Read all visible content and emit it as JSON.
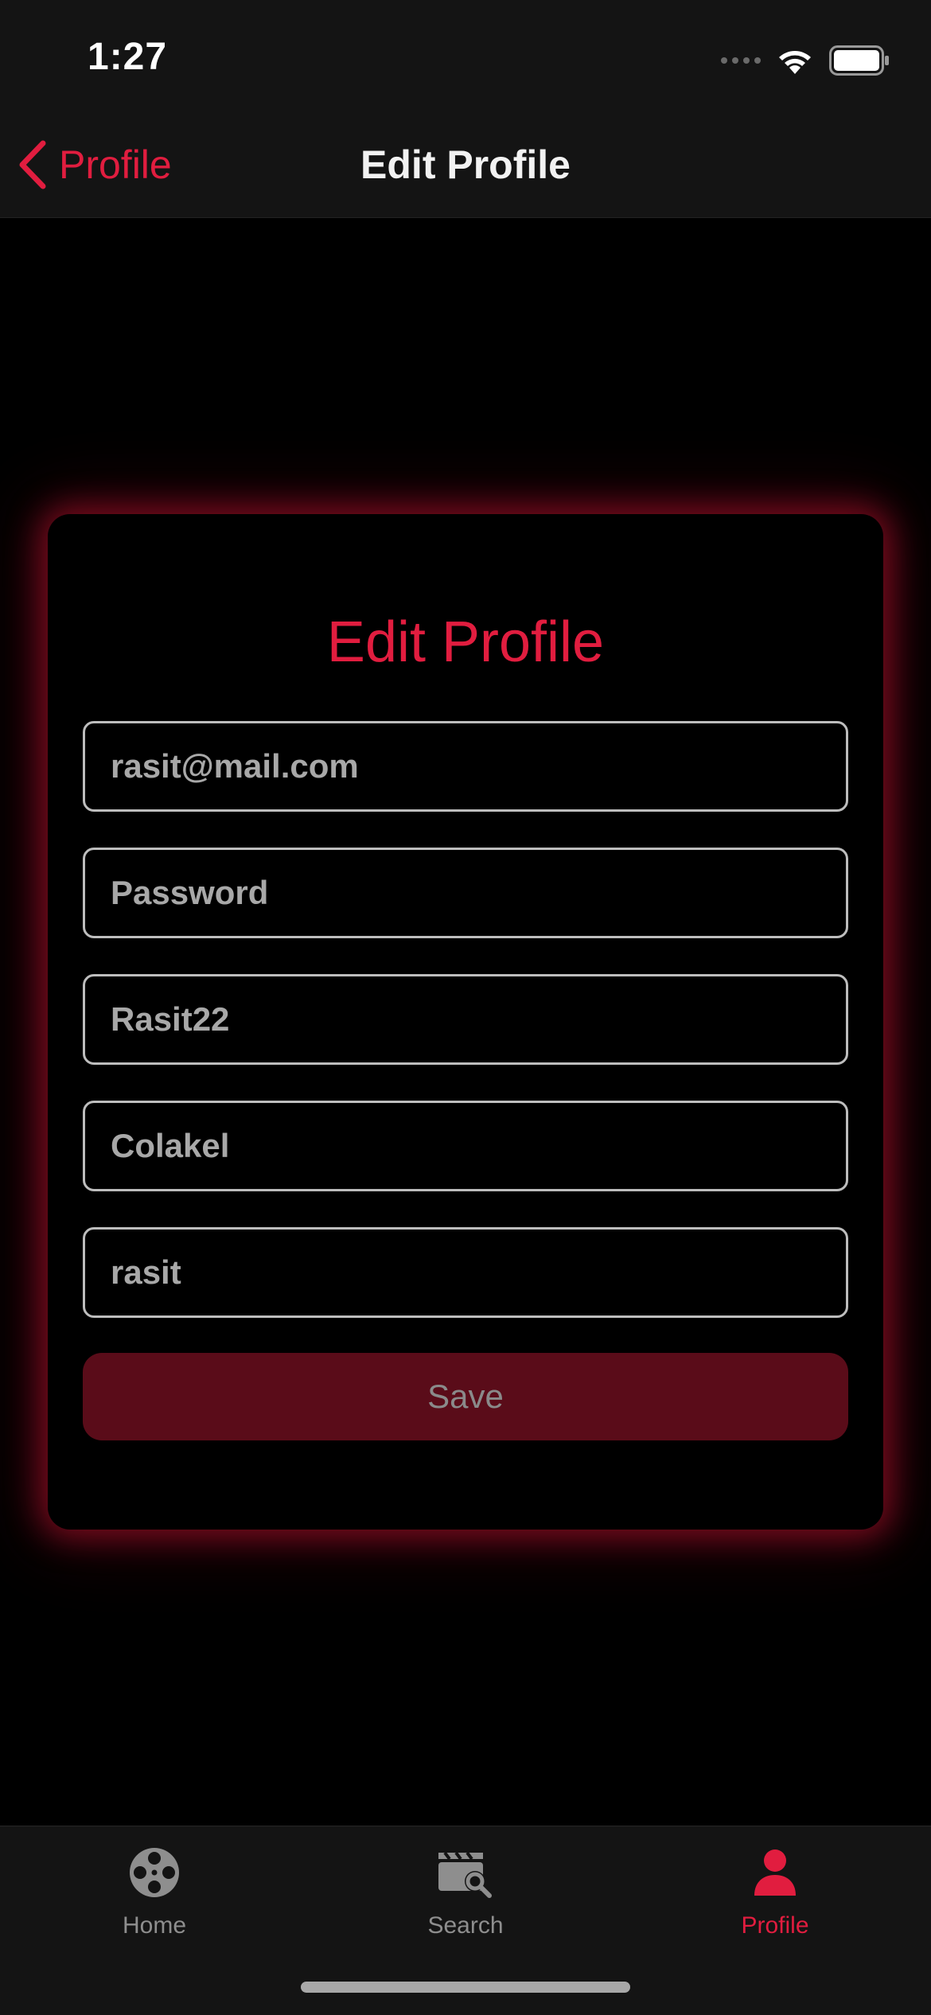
{
  "status_bar": {
    "time": "1:27",
    "icons": [
      "cellular-dots-icon",
      "wifi-icon",
      "battery-icon"
    ]
  },
  "nav": {
    "back_label": "Profile",
    "title": "Edit Profile"
  },
  "form": {
    "title": "Edit Profile",
    "email_value": "rasit@mail.com",
    "password_placeholder": "Password",
    "username_value": "Rasit22",
    "lastname_value": "Colakel",
    "firstname_value": "rasit",
    "save_label": "Save"
  },
  "tabs": [
    {
      "label": "Home",
      "icon": "film-reel-icon"
    },
    {
      "label": "Search",
      "icon": "clapperboard-search-icon"
    },
    {
      "label": "Profile",
      "icon": "person-icon",
      "active": true
    }
  ],
  "colors": {
    "accent": "#e11d3f",
    "save_bg": "#5a0c19",
    "bar_bg": "#141414",
    "field_border": "#bdbdbd",
    "field_text": "#a8a8a8"
  }
}
